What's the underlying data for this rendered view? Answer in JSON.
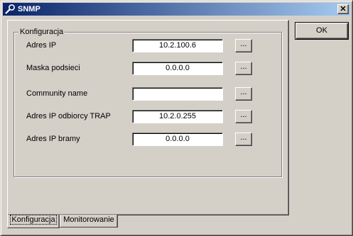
{
  "window": {
    "title": "SNMP",
    "close_label": "✕"
  },
  "dialog": {
    "ok_label": "OK"
  },
  "group": {
    "label": "Konfiguracja"
  },
  "fields": [
    {
      "label": "Adres IP",
      "value": "10.2.100.6",
      "button": "..."
    },
    {
      "label": "Maska podsieci",
      "value": "0.0.0.0",
      "button": "..."
    },
    {
      "label": "Community name",
      "value": "",
      "button": "..."
    },
    {
      "label": "Adres IP odbiorcy TRAP",
      "value": "10.2.0.255",
      "button": "..."
    },
    {
      "label": "Adres IP bramy",
      "value": "0.0.0.0",
      "button": "..."
    }
  ],
  "tabs": [
    {
      "label": "Konfiguracja",
      "active": true
    },
    {
      "label": "Monitorowanie",
      "active": false
    }
  ],
  "icons": {
    "title_icon": "wrench-icon"
  }
}
